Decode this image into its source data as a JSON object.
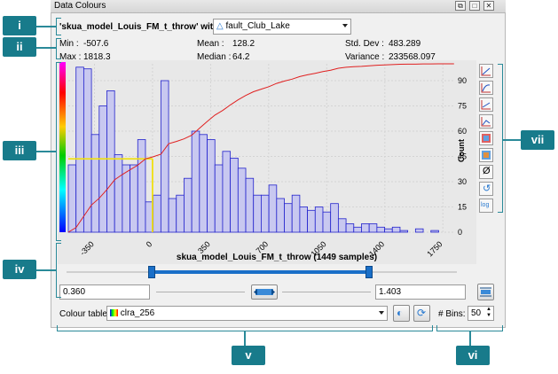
{
  "window": {
    "title": "Data Colours"
  },
  "callouts": [
    "i",
    "ii",
    "iii",
    "iv",
    "v",
    "vi",
    "vii"
  ],
  "property": {
    "name": "'skua_model_Louis_FM_t_throw' within",
    "within_value": "fault_Club_Lake"
  },
  "stats": {
    "min_label": "Min :",
    "min": "-507.6",
    "max_label": "Max :",
    "max": "1818.3",
    "mean_label": "Mean :",
    "mean": "128.2",
    "median_label": "Median :",
    "median": "64.2",
    "std_label": "Std. Dev :",
    "std": "483.289",
    "var_label": "Variance :",
    "var": "233568.097"
  },
  "chart_data": {
    "type": "bar",
    "xlabel": "skua_model_Louis_FM_t_throw (1449 samples)",
    "ylabel": "Count",
    "xlim": [
      -507.6,
      1818.3
    ],
    "ylim": [
      0,
      100
    ],
    "x_ticks": [
      -350,
      0,
      350,
      700,
      1050,
      1400,
      1750
    ],
    "y_ticks": [
      0,
      15,
      30,
      45,
      60,
      75,
      90
    ],
    "bin_width": 46.5,
    "values": [
      40,
      98,
      97,
      58,
      75,
      84,
      46,
      40,
      40,
      55,
      18,
      22,
      90,
      20,
      22,
      32,
      60,
      58,
      55,
      40,
      48,
      44,
      38,
      32,
      22,
      22,
      28,
      20,
      17,
      22,
      15,
      13,
      15,
      12,
      17,
      8,
      5,
      3,
      5,
      5,
      3,
      2,
      3,
      1,
      0,
      2,
      0,
      1,
      0,
      0
    ],
    "cumulative_curve": true,
    "colour_window": {
      "low": 0.36,
      "high": 1.403
    }
  },
  "range": {
    "low": "0.360",
    "high": "1.403"
  },
  "colour_table": {
    "label": "Colour table :",
    "value": "clra_256"
  },
  "bins": {
    "label": "# Bins:",
    "value": "50"
  },
  "colors": {
    "bar_fill": "#c8c8f0",
    "bar_stroke": "#2222cc",
    "curve": "#e02020",
    "highlight": "#f0e010",
    "slider": "#1a6fc8",
    "callout": "#187b8b"
  }
}
